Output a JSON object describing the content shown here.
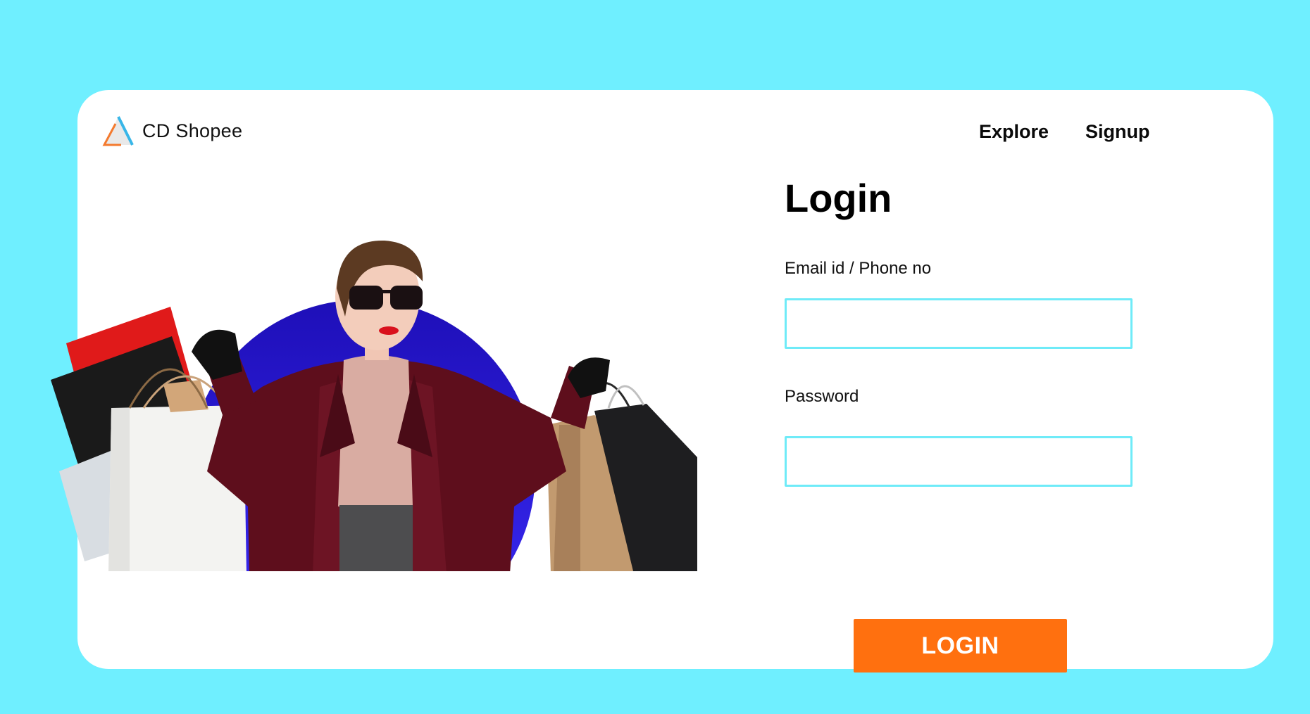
{
  "brand": {
    "name": "CD Shopee",
    "logo_icon": "triangle-logo-icon"
  },
  "nav": {
    "items": [
      {
        "label": "Explore"
      },
      {
        "label": "Signup"
      }
    ]
  },
  "login": {
    "title": "Login",
    "email_label": "Email id / Phone no",
    "email_value": "",
    "password_label": "Password",
    "password_value": "",
    "submit_label": "LOGIN"
  },
  "hero": {
    "image": "woman-with-shopping-bags",
    "circle_color": "#2A1BF0"
  },
  "colors": {
    "page_background": "#6FEFFF",
    "card_background": "#FFFFFF",
    "accent_button": "#FF700F",
    "input_border": "#6FEBF8"
  }
}
